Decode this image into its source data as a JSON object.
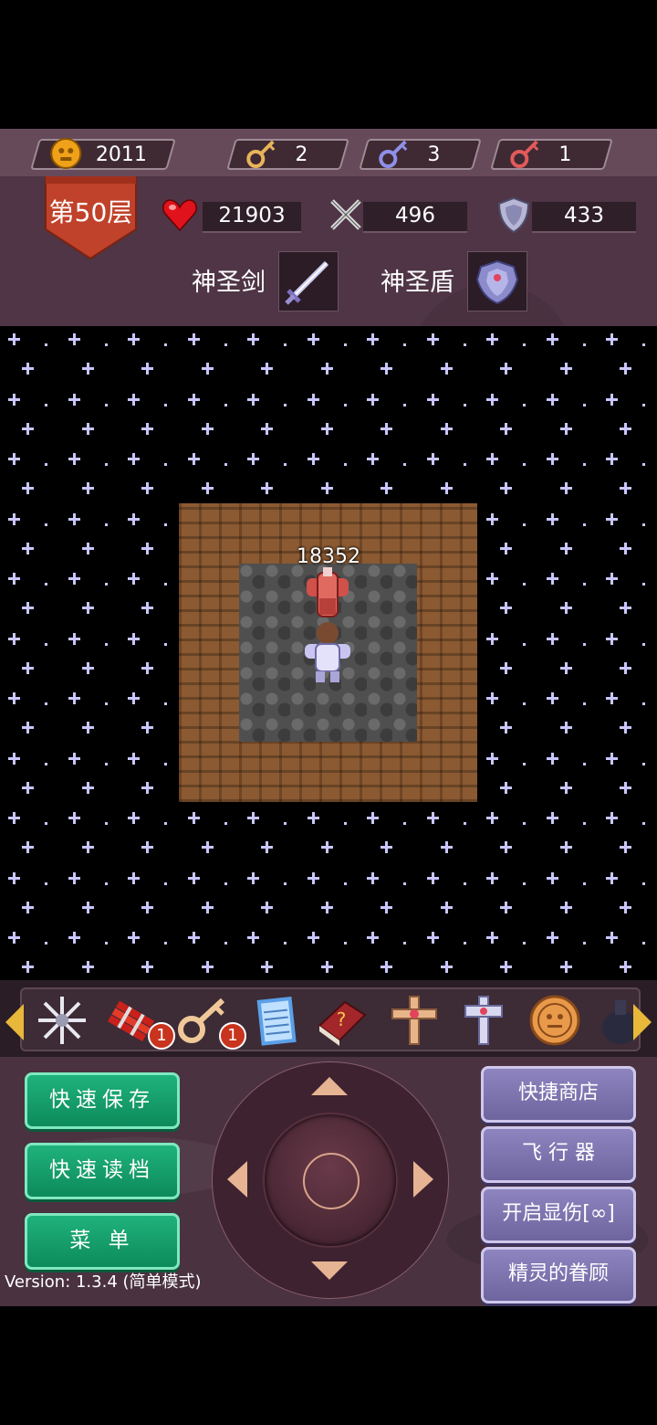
{
  "resources": {
    "gold": "2011",
    "yellow_keys": "2",
    "blue_keys": "3",
    "red_keys": "1"
  },
  "floor": {
    "label": "第50层"
  },
  "stats": {
    "hp": "21903",
    "attack": "496",
    "defense": "433"
  },
  "equipment": {
    "weapon_label": "神圣剑",
    "shield_label": "神圣盾"
  },
  "map": {
    "damage_display": "18352"
  },
  "toolbar": {
    "items": [
      {
        "icon": "snowflake-crystal-icon"
      },
      {
        "icon": "dynamite-icon",
        "count": "1"
      },
      {
        "icon": "key-icon",
        "count": "1"
      },
      {
        "icon": "notepad-icon"
      },
      {
        "icon": "monster-book-icon"
      },
      {
        "icon": "holy-cross-icon"
      },
      {
        "icon": "holy-cross-silver-icon"
      },
      {
        "icon": "coin-face-icon"
      },
      {
        "icon": "potion-jar-icon"
      }
    ]
  },
  "controls": {
    "quick_save": "快速保存",
    "quick_load": "快速读档",
    "menu": "菜 单",
    "shop": "快捷商店",
    "flyer": "飞 行 器",
    "show_damage": "开启显伤[∞]",
    "spirit": "精灵的眷顾"
  },
  "version": "Version: 1.3.4 (简单模式)",
  "colors": {
    "green_button": "#0d8a5b",
    "purple_button": "#7a70ad",
    "floor_badge": "#c0422a",
    "panel_bg": "#4a3240"
  }
}
